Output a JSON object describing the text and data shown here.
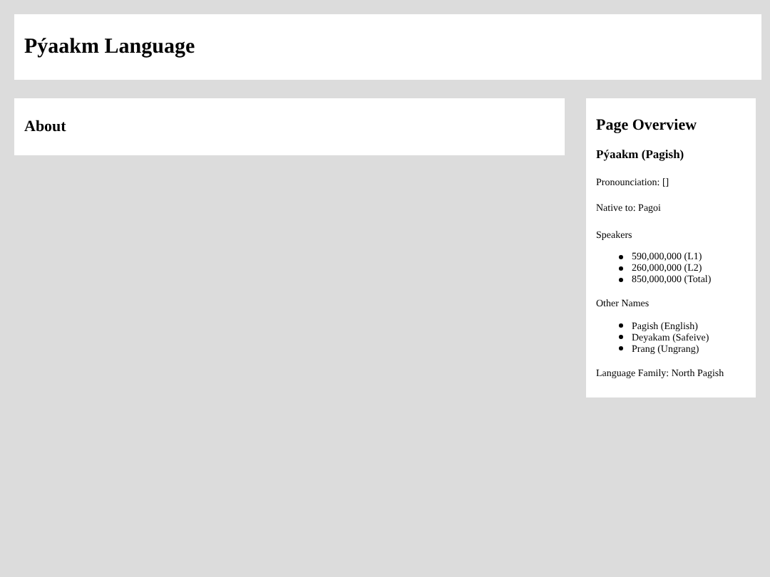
{
  "header": {
    "title": "Pýaakm Language"
  },
  "main": {
    "heading": "About"
  },
  "sidebar": {
    "title": "Page Overview",
    "subtitle": "Pýaakm (Pagish)",
    "pronunciation": "Pronounciation: []",
    "native": "Native to: Pagoi",
    "speakers_label": "Speakers",
    "speakers": [
      "590,000,000 (L1)",
      "260,000,000 (L2)",
      "850,000,000 (Total)"
    ],
    "other_names_label": "Other Names",
    "other_names": [
      "Pagish (English)",
      "Deyakam (Safeive)",
      "Prang (Ungrang)"
    ],
    "family": "Language Family: North Pagish"
  }
}
